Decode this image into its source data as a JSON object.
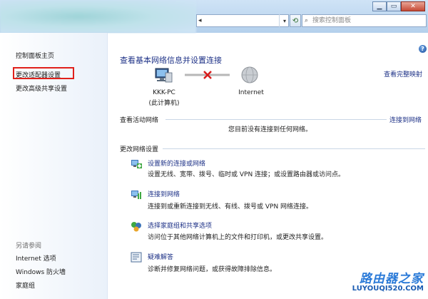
{
  "address": {
    "value": "◂",
    "dropdown": "▾"
  },
  "search": {
    "placeholder": "搜索控制面板"
  },
  "window_buttons": {
    "minimize": "▁",
    "maximize": "▭",
    "close": "✕"
  },
  "sidebar": {
    "home": "控制面板主页",
    "change_adapter": "更改适配器设置",
    "advanced_sharing": "更改高级共享设置",
    "see_also_header": "另请参阅",
    "see_also": [
      "Internet 选项",
      "Windows 防火墙",
      "家庭组"
    ]
  },
  "main": {
    "title": "查看基本网络信息并设置连接",
    "full_map": "查看完整映射",
    "computer_name": "KKK-PC",
    "computer_sub": "(此计算机)",
    "internet": "Internet",
    "active_networks_title": "查看活动网络",
    "connect_link": "连接到网络",
    "not_connected": "您目前没有连接到任何网络。",
    "change_settings_title": "更改网络设置",
    "tasks": [
      {
        "link": "设置新的连接或网络",
        "desc": "设置无线、宽带、拨号、临时或 VPN 连接；或设置路由器或访问点。"
      },
      {
        "link": "连接到网络",
        "desc": "连接到或重新连接到无线、有线、拨号或 VPN 网络连接。"
      },
      {
        "link": "选择家庭组和共享选项",
        "desc": "访问位于其他网络计算机上的文件和打印机，或更改共享设置。"
      },
      {
        "link": "疑难解答",
        "desc": "诊断并修复网络问题，或获得故障排除信息。"
      }
    ]
  },
  "watermark": {
    "top": "路由器之家",
    "bottom": "LUYOUQI520.COM"
  },
  "colors": {
    "link": "#1e3287",
    "highlight_box": "#e0201b",
    "watermark": "#2a7ad8"
  }
}
